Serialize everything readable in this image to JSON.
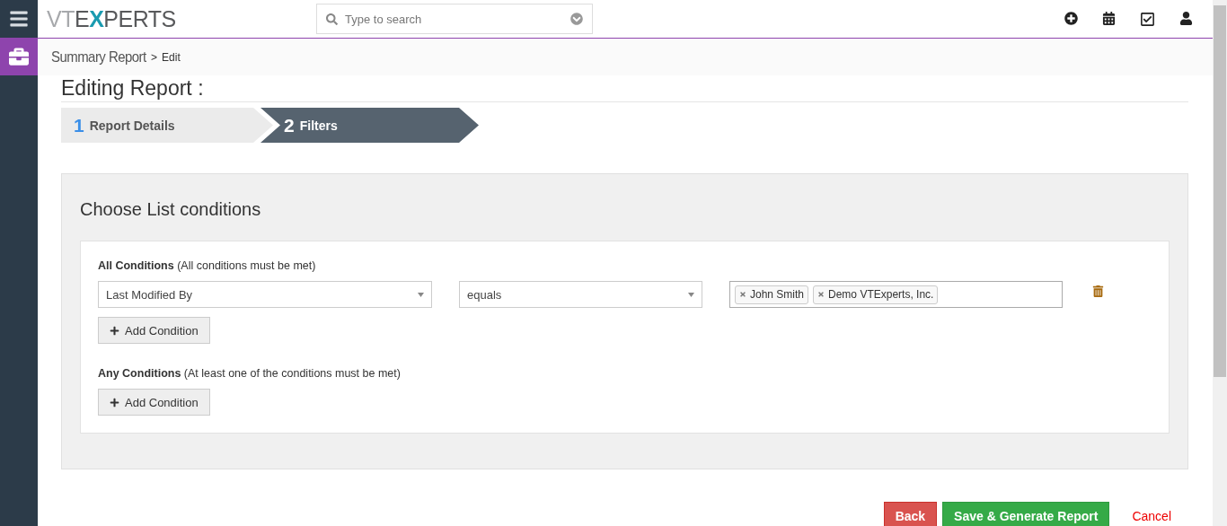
{
  "logo": {
    "parts": [
      {
        "text": "VT",
        "color": "#a7a9ac"
      },
      {
        "text": "E",
        "color": "#58595b"
      },
      {
        "text": "X",
        "color": "#1a9bb0"
      },
      {
        "text": "PERTS",
        "color": "#58595b"
      }
    ]
  },
  "search": {
    "placeholder": "Type to search"
  },
  "breadcrumb": {
    "module": "Summary Report",
    "separator": ">",
    "current": "Edit"
  },
  "page_title": "Editing Report :",
  "steps": [
    {
      "number": "1",
      "label": "Report Details",
      "selected": false
    },
    {
      "number": "2",
      "label": "Filters",
      "selected": true
    }
  ],
  "panel": {
    "title": "Choose List conditions",
    "sections": [
      {
        "title": "All Conditions",
        "hint": "(All conditions must be met)",
        "conditions": [
          {
            "field": "Last Modified By",
            "operator": "equals",
            "values": [
              "John Smith",
              "Demo VTExperts, Inc."
            ]
          }
        ],
        "button": "Add Condition"
      },
      {
        "title": "Any Conditions",
        "hint": "(At least one of the conditions must be met)",
        "button": "Add Condition"
      }
    ]
  },
  "actions": [
    {
      "label": "Back",
      "kind": "danger"
    },
    {
      "label": "Save & Generate Report",
      "kind": "success"
    },
    {
      "label": "Cancel",
      "kind": "link"
    }
  ]
}
